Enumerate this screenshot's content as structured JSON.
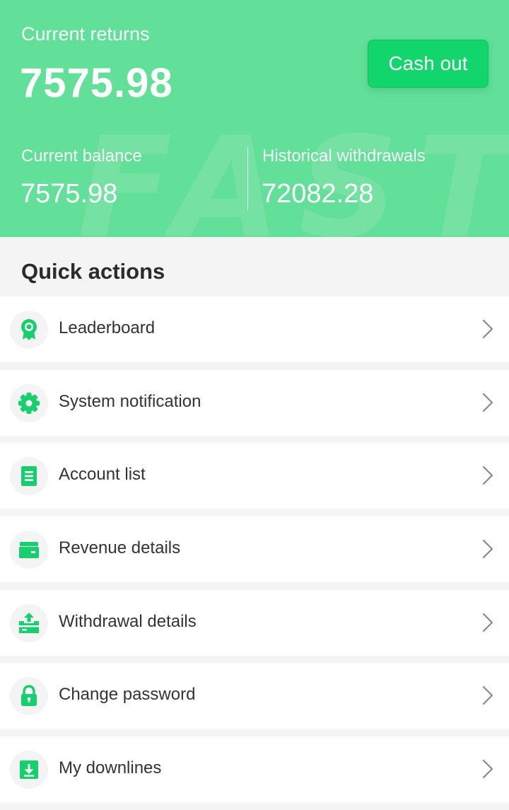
{
  "header": {
    "watermark": "FAST",
    "returns_label": "Current returns",
    "returns_value": "7575.98",
    "cashout_label": "Cash out",
    "balance_label": "Current balance",
    "balance_value": "7575.98",
    "withdrawals_label": "Historical withdrawals",
    "withdrawals_value": "72082.28"
  },
  "quick_actions": {
    "title": "Quick actions",
    "items": [
      {
        "label": "Leaderboard",
        "icon": "ribbon-award-icon"
      },
      {
        "label": "System notification",
        "icon": "gear-icon"
      },
      {
        "label": "Account list",
        "icon": "document-list-icon"
      },
      {
        "label": "Revenue details",
        "icon": "wallet-icon"
      },
      {
        "label": "Withdrawal details",
        "icon": "upload-tray-icon"
      },
      {
        "label": "Change password",
        "icon": "padlock-icon"
      },
      {
        "label": "My downlines",
        "icon": "download-box-icon"
      }
    ]
  },
  "colors": {
    "header_bg": "#62df98",
    "accent": "#12d66b",
    "icon_green": "#16d06d"
  }
}
